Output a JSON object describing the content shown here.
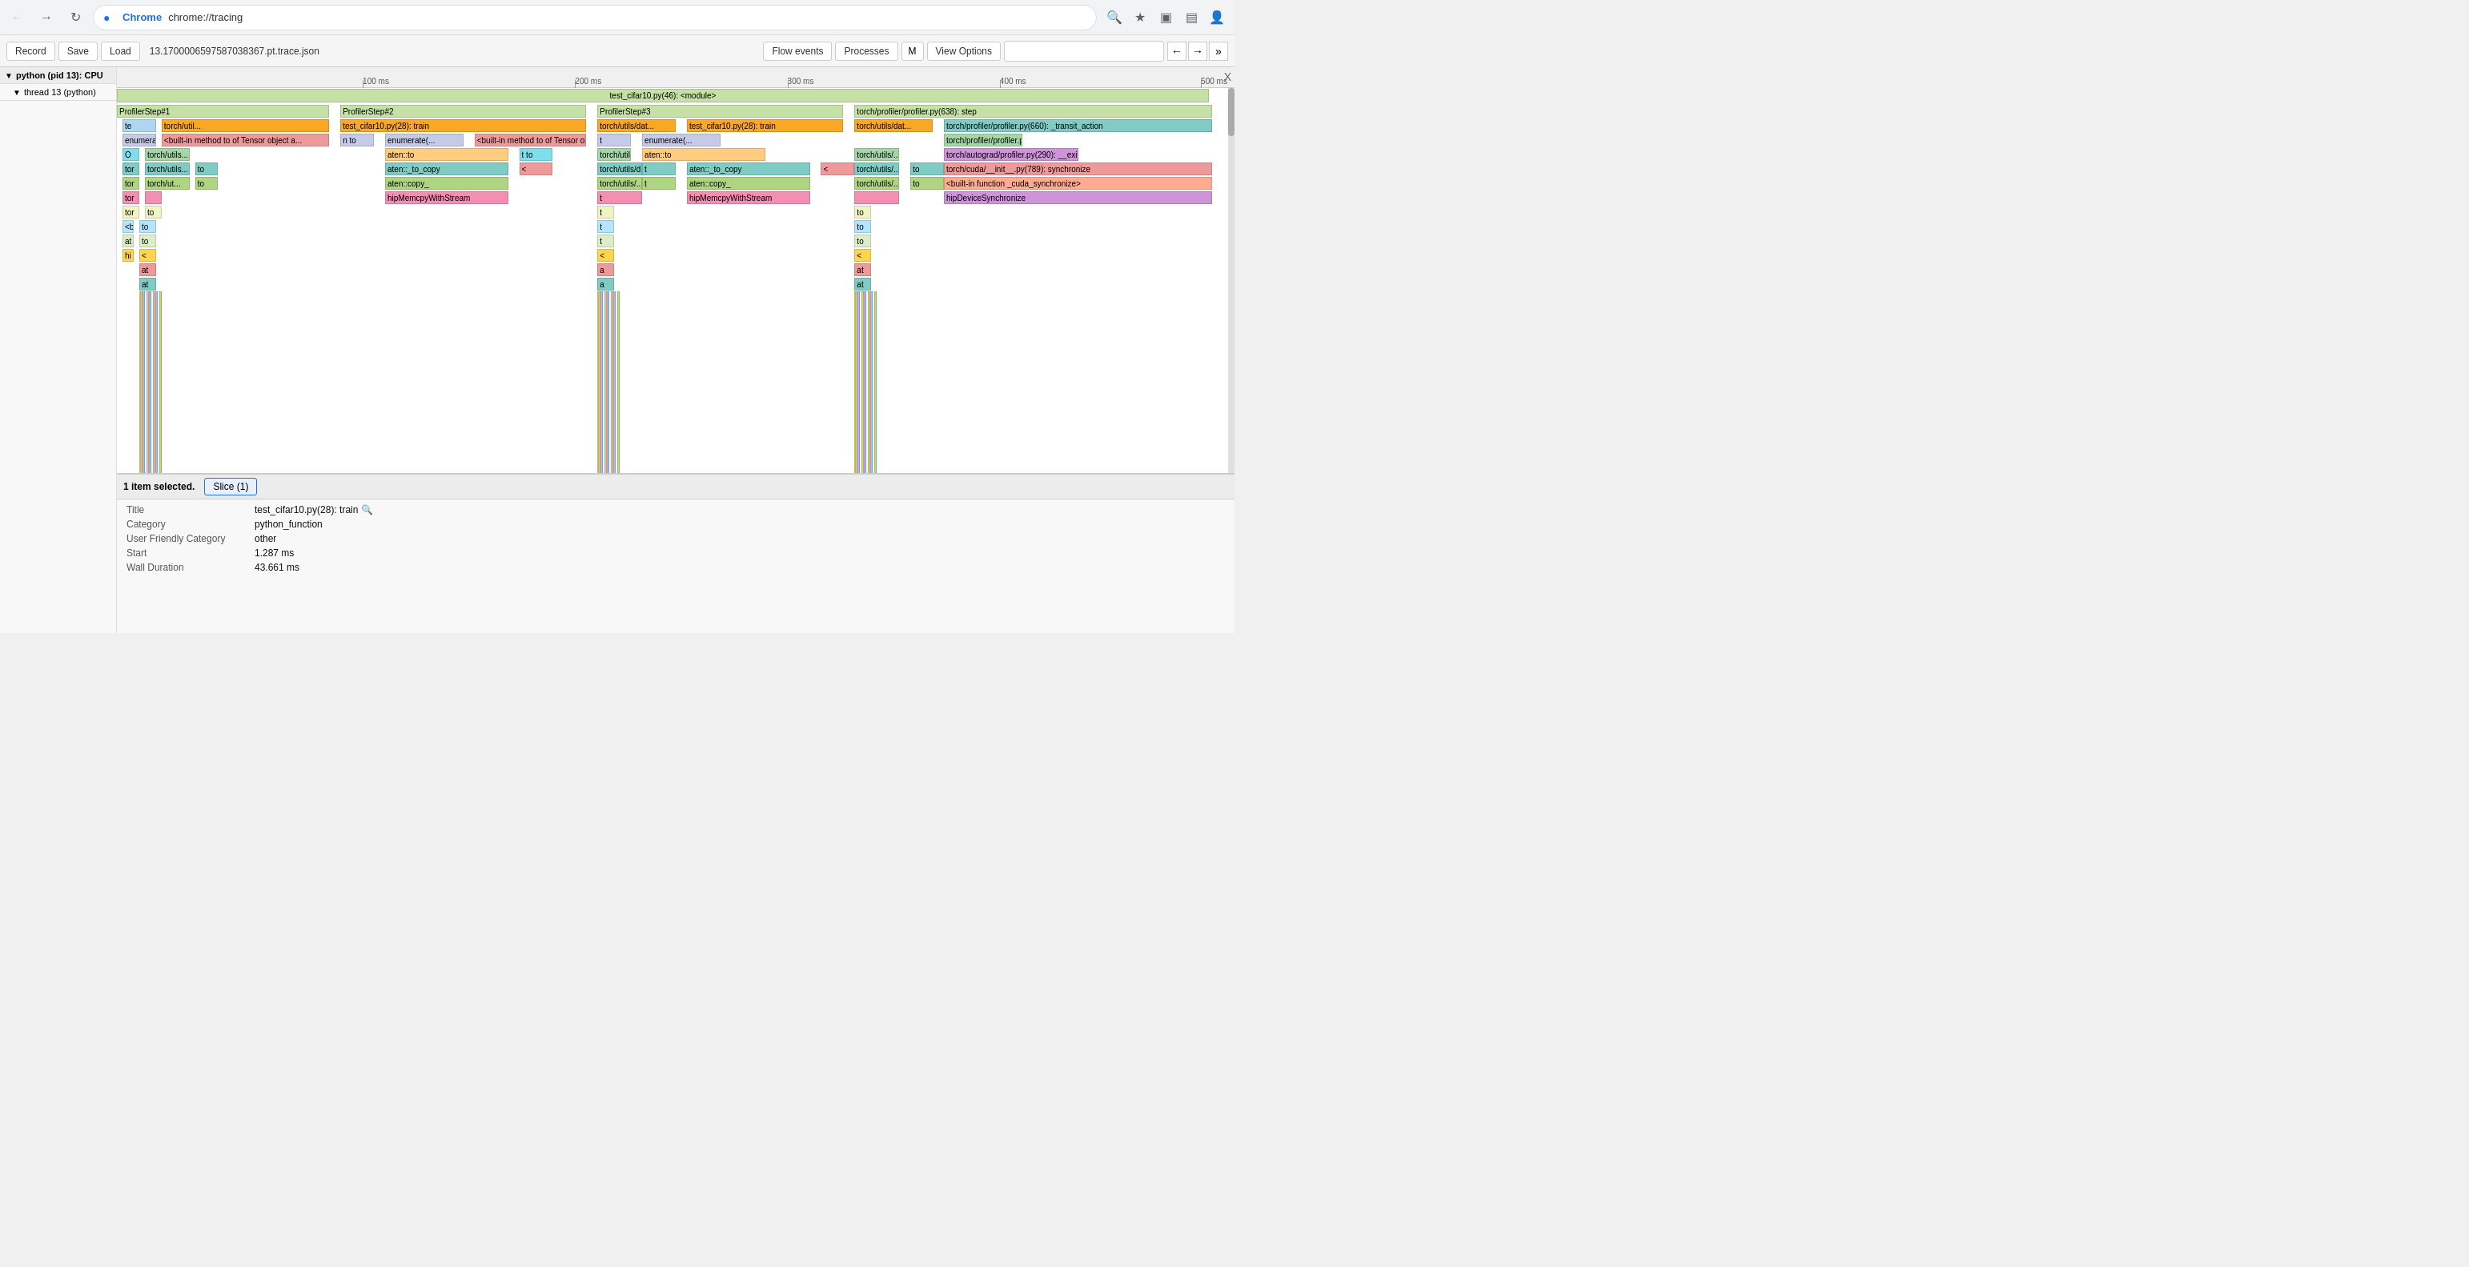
{
  "browser": {
    "back_btn": "←",
    "forward_btn": "→",
    "reload_btn": "↺",
    "favicon_char": "●",
    "site_name": "Chrome",
    "url": "chrome://tracing",
    "zoom_icon": "🔍",
    "star_icon": "☆",
    "ext_icon": "⬜",
    "split_icon": "▣",
    "avatar_icon": "👤"
  },
  "toolbar": {
    "record_label": "Record",
    "save_label": "Save",
    "load_label": "Load",
    "filename": "13.170000659758703 8367.pt.trace.json",
    "flow_events_label": "Flow events",
    "processes_label": "Processes",
    "m_label": "M",
    "view_options_label": "View Options",
    "search_placeholder": "",
    "nav_left": "←",
    "nav_right": "→",
    "nav_expand": "»"
  },
  "process_tree": {
    "process_label": "python (pid 13): CPU",
    "thread_label": "thread 13 (python)"
  },
  "timeline": {
    "ticks": [
      "100 ms",
      "200 ms",
      "300 ms",
      "400 ms",
      "500 ms"
    ]
  },
  "trace_blocks": [
    {
      "id": "ps1",
      "label": "ProfilerStep#1",
      "color": "#c5e1a5",
      "level": 0
    },
    {
      "id": "ps2",
      "label": "ProfilerStep#2",
      "color": "#c5e1a5",
      "level": 0
    },
    {
      "id": "ps3",
      "label": "ProfilerStep#3",
      "color": "#c5e1a5",
      "level": 0
    },
    {
      "id": "ps4",
      "label": "torch/profiler/profiler.py(638): step",
      "color": "#c5e1a5",
      "level": 0
    }
  ],
  "bottom_panel": {
    "selected_text": "1 item selected.",
    "tab_label": "Slice (1)",
    "title_label": "Title",
    "title_value": "test_cifar10.py(28): train",
    "category_label": "Category",
    "category_value": "python_function",
    "user_friendly_label": "User Friendly Category",
    "user_friendly_value": "other",
    "start_label": "Start",
    "start_value": "1.287 ms",
    "wall_duration_label": "Wall Duration",
    "wall_duration_value": "43.661 ms"
  },
  "close_btn": "X"
}
